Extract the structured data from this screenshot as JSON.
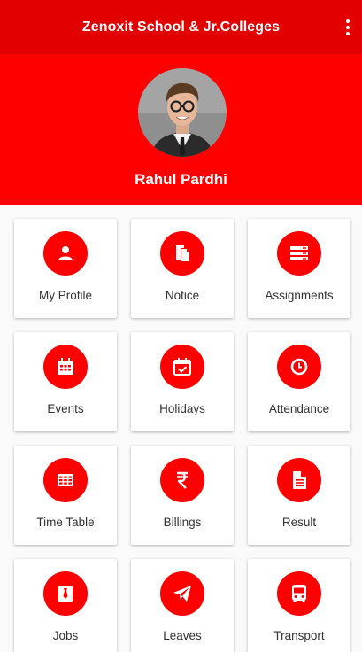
{
  "app_bar": {
    "title": "Zenoxit School & Jr.Colleges",
    "menu_icon": "more-vert-icon"
  },
  "profile": {
    "name": "Rahul Pardhi"
  },
  "colors": {
    "app_bar": "#e30000",
    "header": "#ff0000",
    "icon_circle": "#ff0000",
    "background": "#fafafa"
  },
  "menu": {
    "items": [
      {
        "label": "My Profile",
        "icon": "person-icon"
      },
      {
        "label": "Notice",
        "icon": "notice-icon"
      },
      {
        "label": "Assignments",
        "icon": "assignments-icon"
      },
      {
        "label": "Events",
        "icon": "calendar-icon"
      },
      {
        "label": "Holidays",
        "icon": "calendar-check-icon"
      },
      {
        "label": "Attendance",
        "icon": "clock-icon"
      },
      {
        "label": "Time Table",
        "icon": "table-icon"
      },
      {
        "label": "Billings",
        "icon": "rupee-icon"
      },
      {
        "label": "Result",
        "icon": "document-icon"
      },
      {
        "label": "Jobs",
        "icon": "tie-icon"
      },
      {
        "label": "Leaves",
        "icon": "paper-plane-icon"
      },
      {
        "label": "Transport",
        "icon": "bus-icon"
      }
    ]
  }
}
